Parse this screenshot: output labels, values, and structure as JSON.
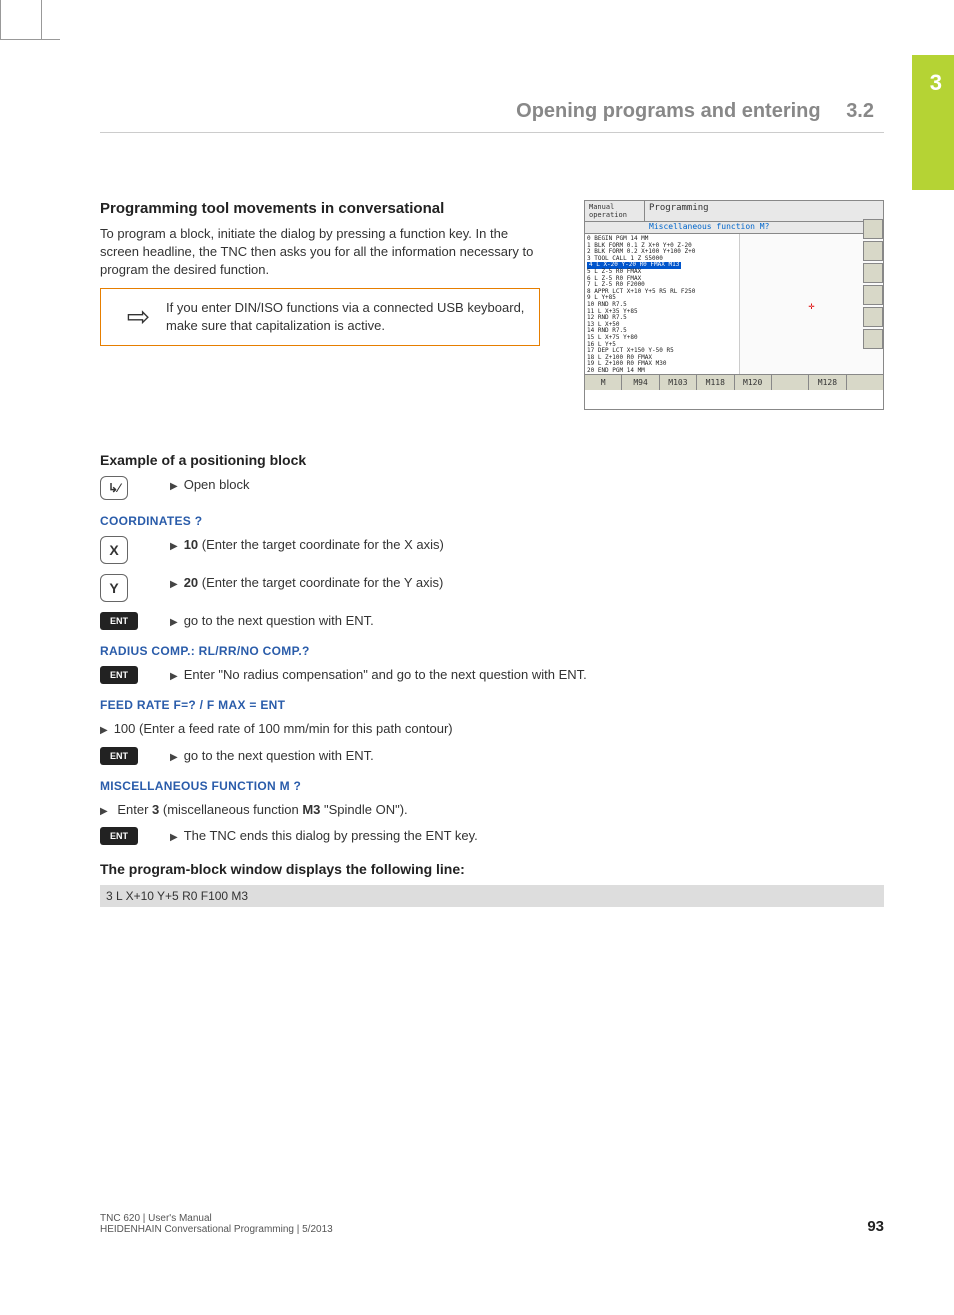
{
  "chapter_number": "3",
  "header": {
    "title": "Opening programs and entering",
    "section": "3.2"
  },
  "intro": {
    "heading": "Programming tool movements in conversational",
    "p1": "To program a block, initiate the dialog by pressing a function key. In the screen headline, the TNC then asks you for all the information necessary to program the desired function.",
    "note": "If you enter DIN/ISO functions via a connected USB keyboard, make sure that capitalization is active."
  },
  "screenshot": {
    "mode": "Manual operation",
    "title": "Programming",
    "subtitle": "Miscellaneous function M?",
    "lines": [
      "0  BEGIN PGM 14 MM",
      "1  BLK FORM 0.1 Z X+0 Y+0 Z-20",
      "2  BLK FORM 0.2  X+100  Y+100  Z+0",
      "3  TOOL CALL 1 Z S5000",
      "HL4",
      "5  L  Z-5 R0 FMAX",
      "6  L  Z-5 R0 FMAX",
      "7  L  Z-5 R0 F2000",
      "8  APPR LCT  X+10  Y+5 R5 RL F250",
      "9  L  Y+85",
      "10 RND R7.5",
      "11 L  X+35  Y+85",
      "12 RND R7.5",
      "13 L  X+50",
      "14 RND R7.5",
      "15 L  X+75  Y+80",
      "16 L  Y+5",
      "17 DEP LCT  X+150  Y-50 R5",
      "18 L  Z+100 R0 FMAX",
      "19 L  Z+100 R0 FMAX M30",
      "20 END PGM 14 MM"
    ],
    "hl_line": "4  L  X-20  Y-20 R0 FMAX M13",
    "softkeys": [
      "M",
      "M94",
      "M103",
      "M118",
      "M120",
      "",
      "M128",
      ""
    ]
  },
  "example": {
    "heading": "Example of a positioning block",
    "open_block": "Open block",
    "coords_h": "COORDINATES ?",
    "x_key": "X",
    "x_val": "10",
    "x_desc": " (Enter the target coordinate for the X axis)",
    "y_key": "Y",
    "y_val": "20",
    "y_desc": " (Enter the target coordinate for the Y axis)",
    "ent": "ENT",
    "ent_desc": "go to the next question with ENT.",
    "radius_h": "RADIUS COMP.: RL/RR/NO COMP.?",
    "radius_desc": "Enter \"No radius compensation\" and go to the next question with ENT.",
    "feed_h": "FEED RATE F=? / F MAX = ENT",
    "feed_bullet": "100 (Enter a feed rate of 100 mm/min for this path contour)",
    "feed_ent": "go to the next question with ENT.",
    "misc_h": "MISCELLANEOUS FUNCTION M ?",
    "misc_bullet_pre": "Enter ",
    "misc_bullet_3": "3",
    "misc_bullet_mid": " (miscellaneous function ",
    "misc_bullet_m3": "M3",
    "misc_bullet_post": " \"Spindle ON\").",
    "misc_ent": "The TNC ends this dialog by pressing the ENT key.",
    "result_h": "The program-block window displays the following line:",
    "result_code": "3 L X+10 Y+5 R0 F100 M3"
  },
  "footer": {
    "line1": "TNC 620 | User's Manual",
    "line2": "HEIDENHAIN Conversational Programming | 5/2013",
    "page": "93"
  }
}
